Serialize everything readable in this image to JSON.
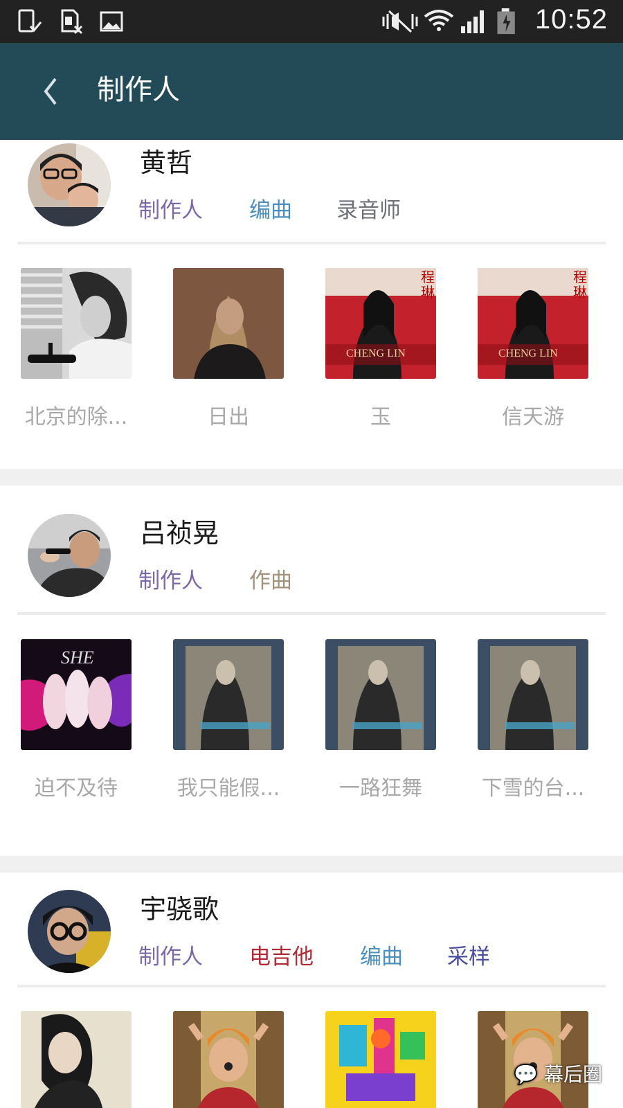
{
  "status_bar": {
    "time": "10:52",
    "left_icons": [
      "phone-check-icon",
      "sim-blocked-icon",
      "image-icon"
    ],
    "right_icons": [
      "vibrate-mute-icon",
      "wifi-icon",
      "signal-icon",
      "battery-icon"
    ]
  },
  "app_bar": {
    "title": "制作人",
    "back_icon": "chevron-left-icon",
    "background": "#234b57"
  },
  "producers": [
    {
      "name": "黄哲",
      "roles": [
        {
          "label": "制作人",
          "color": "#7a68a8"
        },
        {
          "label": "编曲",
          "color": "#4b8fbe"
        },
        {
          "label": "录音师",
          "color": "#6f7178"
        }
      ],
      "albums": [
        {
          "title": "北京的除..."
        },
        {
          "title": "日出"
        },
        {
          "title": "玉"
        },
        {
          "title": "信天游"
        }
      ]
    },
    {
      "name": "吕祯晃",
      "roles": [
        {
          "label": "制作人",
          "color": "#7a68a8"
        },
        {
          "label": "作曲",
          "color": "#a0927c"
        }
      ],
      "albums": [
        {
          "title": "迫不及待"
        },
        {
          "title": "我只能假..."
        },
        {
          "title": "一路狂舞"
        },
        {
          "title": "下雪的台..."
        }
      ]
    },
    {
      "name": "宇骁歌",
      "roles": [
        {
          "label": "制作人",
          "color": "#7a68a8"
        },
        {
          "label": "电吉他",
          "color": "#b02a35"
        },
        {
          "label": "编曲",
          "color": "#4b8fbe"
        },
        {
          "label": "采样",
          "color": "#4a4e9a"
        }
      ],
      "albums": [
        {
          "title": ""
        },
        {
          "title": ""
        },
        {
          "title": ""
        },
        {
          "title": ""
        }
      ]
    }
  ],
  "watermark": "幕后圈"
}
